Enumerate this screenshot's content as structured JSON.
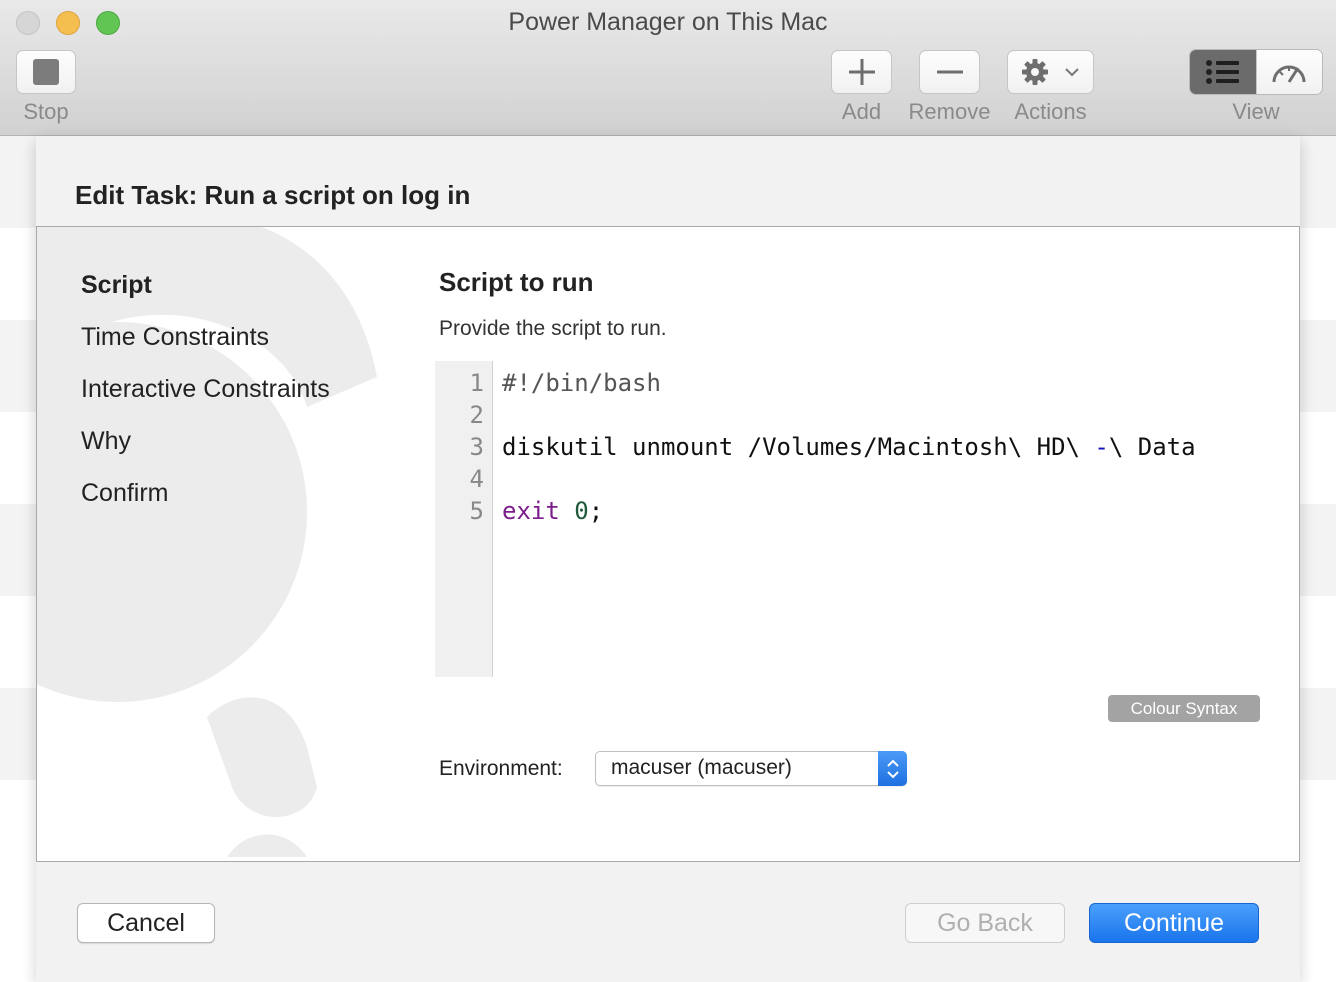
{
  "window": {
    "title": "Power Manager on This Mac"
  },
  "toolbar": {
    "stop_label": "Stop",
    "add_label": "Add",
    "remove_label": "Remove",
    "actions_label": "Actions",
    "view_label": "View"
  },
  "sheet": {
    "title": "Edit Task: Run a script on log in",
    "steps": [
      {
        "label": "Script",
        "active": true
      },
      {
        "label": "Time Constraints",
        "active": false
      },
      {
        "label": "Interactive Constraints",
        "active": false
      },
      {
        "label": "Why",
        "active": false
      },
      {
        "label": "Confirm",
        "active": false
      }
    ],
    "section_title": "Script to run",
    "section_desc": "Provide the script to run.",
    "editor": {
      "line_numbers": [
        "1",
        "2",
        "3",
        "4",
        "5"
      ],
      "line1": "#!/bin/bash",
      "line3_a": "diskutil unmount /Volumes/Macintosh\\ HD\\ ",
      "line3_op": "-",
      "line3_b": "\\ Data",
      "line5_kw": "exit",
      "line5_num": "0",
      "line5_end": ";"
    },
    "colour_syntax_label": "Colour Syntax",
    "environment_label": "Environment:",
    "environment_value": "macuser (macuser)"
  },
  "footer": {
    "cancel_label": "Cancel",
    "go_back_label": "Go Back",
    "continue_label": "Continue"
  },
  "colors": {
    "accent": "#1a74ec",
    "keyword": "#7b1d8a",
    "number": "#1f5b3a",
    "operator": "#1010c0"
  }
}
